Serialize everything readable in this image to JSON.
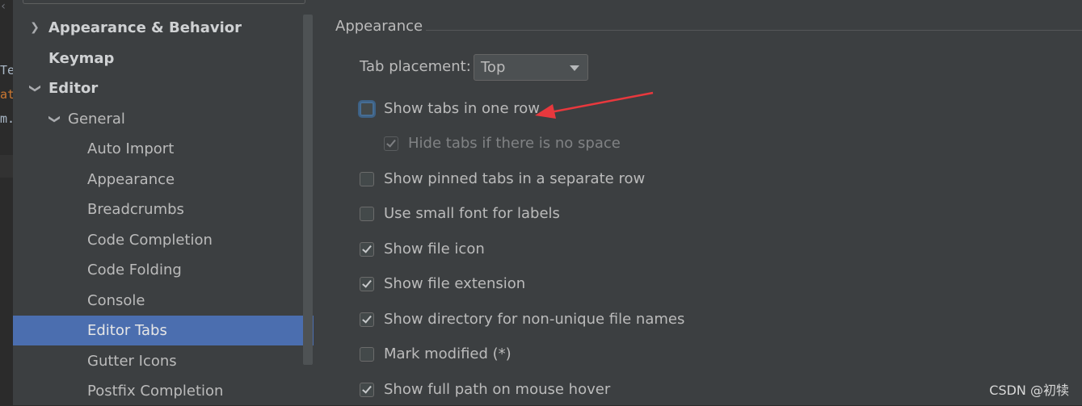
{
  "editor_fragments": {
    "top": "‹",
    "line1": "Te",
    "line2": "at",
    "line3": "m."
  },
  "sidebar": {
    "items": [
      {
        "label": "Appearance & Behavior",
        "expanded": false,
        "bold": true
      },
      {
        "label": "Keymap",
        "bold": true
      },
      {
        "label": "Editor",
        "expanded": true,
        "bold": true
      },
      {
        "label": "General",
        "expanded": true
      },
      {
        "label": "Auto Import"
      },
      {
        "label": "Appearance"
      },
      {
        "label": "Breadcrumbs"
      },
      {
        "label": "Code Completion"
      },
      {
        "label": "Code Folding"
      },
      {
        "label": "Console"
      },
      {
        "label": "Editor Tabs",
        "selected": true
      },
      {
        "label": "Gutter Icons"
      },
      {
        "label": "Postfix Completion"
      }
    ]
  },
  "panel": {
    "group_title": "Appearance",
    "tab_placement_label": "Tab placement:",
    "tab_placement_value": "Top",
    "options": [
      {
        "label": "Show tabs in one row",
        "checked": false,
        "focused": true
      },
      {
        "label": "Hide tabs if there is no space",
        "checked": true,
        "disabled": true
      },
      {
        "label": "Show pinned tabs in a separate row",
        "checked": false
      },
      {
        "label": "Use small font for labels",
        "checked": false
      },
      {
        "label": "Show file icon",
        "checked": true
      },
      {
        "label": "Show file extension",
        "checked": true
      },
      {
        "label": "Show directory for non-unique file names",
        "checked": true
      },
      {
        "label": "Mark modified (*)",
        "checked": false
      },
      {
        "label": "Show full path on mouse hover",
        "checked": true
      }
    ]
  },
  "colors": {
    "selection": "#4b6eaf",
    "annotation_arrow": "#e8383d"
  },
  "watermark": "CSDN @初犊"
}
